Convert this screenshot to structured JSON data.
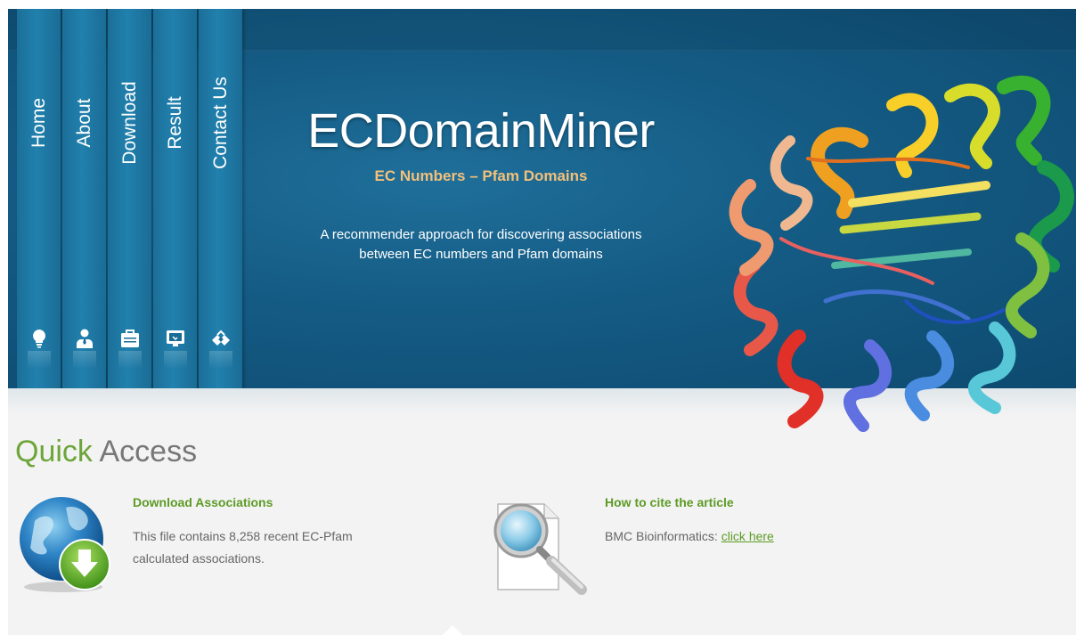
{
  "nav": {
    "items": [
      {
        "label": "Home",
        "icon": "lightbulb-icon"
      },
      {
        "label": "About",
        "icon": "user-icon"
      },
      {
        "label": "Download",
        "icon": "briefcase-icon"
      },
      {
        "label": "Result",
        "icon": "monitor-icon"
      },
      {
        "label": "Contact Us",
        "icon": "handshake-icon"
      }
    ]
  },
  "hero": {
    "title": "ECDomainMiner",
    "subtitle": "EC Numbers – Pfam Domains",
    "description_line1": "A recommender approach for discovering associations",
    "description_line2": "between EC numbers and Pfam domains",
    "image_icon": "protein-structure-icon"
  },
  "quick_access": {
    "title_accent": "Quick",
    "title_rest": "Access",
    "download": {
      "icon": "globe-download-icon",
      "heading": "Download Associations",
      "text_line1": "This file contains 8,258 recent EC-Pfam",
      "text_line2": "calculated associations."
    },
    "cite": {
      "icon": "search-document-icon",
      "heading": "How to cite the article",
      "text": "BMC Bioinformatics: ",
      "link": "click here"
    }
  },
  "colors": {
    "hero_blue": "#145b84",
    "tab_blue": "#2180ad",
    "accent_green": "#5d9b25",
    "subtitle_orange": "#f3c07a"
  }
}
